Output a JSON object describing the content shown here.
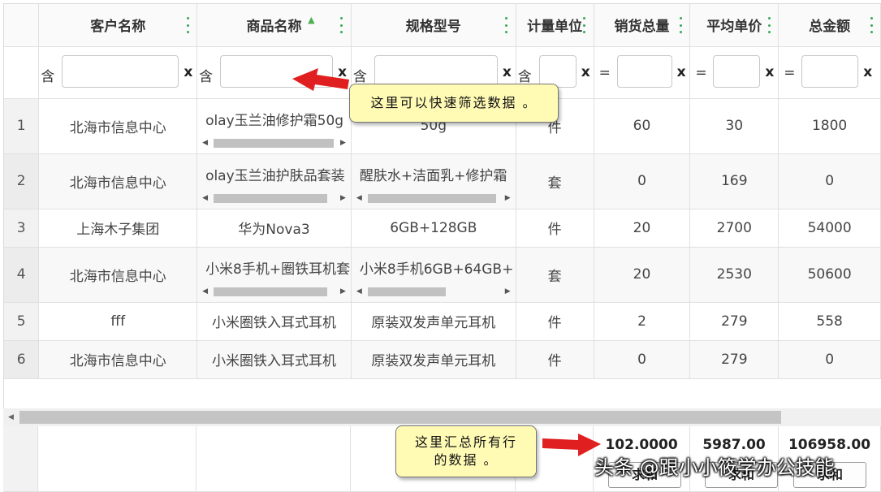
{
  "columns": [
    {
      "key": "idx",
      "label": ""
    },
    {
      "key": "customer",
      "label": "客户名称"
    },
    {
      "key": "product",
      "label": "商品名称"
    },
    {
      "key": "spec",
      "label": "规格型号"
    },
    {
      "key": "unit",
      "label": "计量单位"
    },
    {
      "key": "qty",
      "label": "销货总量"
    },
    {
      "key": "price",
      "label": "平均单价"
    },
    {
      "key": "amount",
      "label": "总金额"
    }
  ],
  "sort_indicator": "sort-up-icon",
  "filters": {
    "customer_op": "含",
    "product_op": "含",
    "spec_op": "含",
    "unit_op": "含",
    "qty_op": "=",
    "price_op": "=",
    "amount_op": "=",
    "clear_label": "x"
  },
  "rows": [
    {
      "idx": "1",
      "customer": "北海市信息中心",
      "product": "olay玉兰油修护霜50g",
      "spec": "50g",
      "unit": "件",
      "qty": "60",
      "price": "30",
      "amount": "1800"
    },
    {
      "idx": "2",
      "customer": "北海市信息中心",
      "product": "olay玉兰油护肤品套装",
      "spec": "醒肤水+洁面乳+修护霜",
      "unit": "套",
      "qty": "0",
      "price": "169",
      "amount": "0"
    },
    {
      "idx": "3",
      "customer": "上海木子集团",
      "product": "华为Nova3",
      "spec": "6GB+128GB",
      "unit": "件",
      "qty": "20",
      "price": "2700",
      "amount": "54000"
    },
    {
      "idx": "4",
      "customer": "北海市信息中心",
      "product": "小米8手机+圈铁耳机套",
      "spec": "小米8手机6GB+64GB+",
      "unit": "套",
      "qty": "20",
      "price": "2530",
      "amount": "50600"
    },
    {
      "idx": "5",
      "customer": "fff",
      "product": "小米圈铁入耳式耳机",
      "spec": "原装双发声单元耳机",
      "unit": "件",
      "qty": "2",
      "price": "279",
      "amount": "558"
    },
    {
      "idx": "6",
      "customer": "北海市信息中心",
      "product": "小米圈铁入耳式耳机",
      "spec": "原装双发声单元耳机",
      "unit": "件",
      "qty": "0",
      "price": "279",
      "amount": "0"
    }
  ],
  "totals": {
    "qty": "102.0000",
    "price": "5987.00",
    "amount": "106958.00",
    "sum_label": "求和"
  },
  "callouts": {
    "filter_tip": "这里可以快速筛选数据 。",
    "total_line1": "这里汇总所有行",
    "total_line2": "的数据 。"
  },
  "watermark": "头条 @跟小小筱学办公技能",
  "colors": {
    "accent": "#37a85a",
    "callout_bg": "#fffbb5",
    "arrow": "#e02020"
  }
}
